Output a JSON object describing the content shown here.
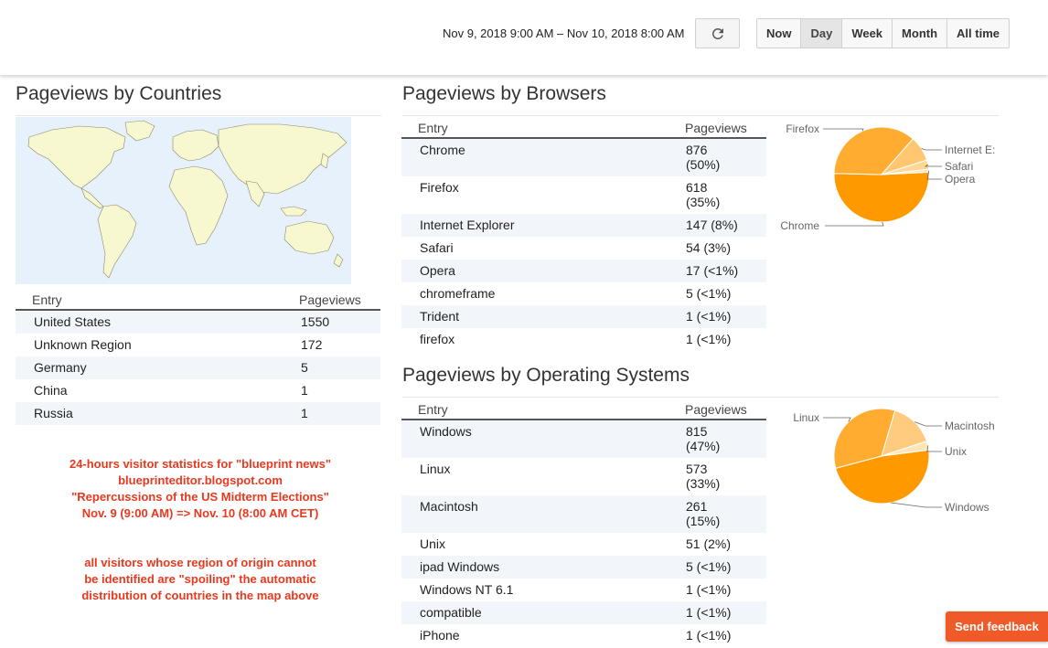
{
  "header": {
    "date_range": "Nov 9, 2018 9:00 AM – Nov 10, 2018 8:00 AM",
    "ranges": [
      {
        "label": "Now",
        "active": false
      },
      {
        "label": "Day",
        "active": true
      },
      {
        "label": "Week",
        "active": false
      },
      {
        "label": "Month",
        "active": false
      },
      {
        "label": "All time",
        "active": false
      }
    ],
    "refresh_icon": "refresh-icon"
  },
  "countries": {
    "title": "Pageviews by Countries",
    "col_entry": "Entry",
    "col_views": "Pageviews",
    "rows": [
      {
        "entry": "United States",
        "views": "1550"
      },
      {
        "entry": "Unknown Region",
        "views": "172"
      },
      {
        "entry": "Germany",
        "views": "5"
      },
      {
        "entry": "China",
        "views": "1"
      },
      {
        "entry": "Russia",
        "views": "1"
      }
    ]
  },
  "annotation": {
    "lines1": [
      "24-hours visitor statistics for \"blueprint news\"",
      "blueprinteditor.blogspot.com",
      "\"Repercussions of the US Midterm Elections\"",
      "Nov. 9 (9:00 AM) => Nov. 10 (8:00 AM CET)"
    ],
    "lines2": [
      "all visitors whose region of origin cannot",
      "be identified are \"spoiling\" the automatic",
      "distribution of countries in the map above"
    ]
  },
  "browsers": {
    "title": "Pageviews by Browsers",
    "col_entry": "Entry",
    "col_views": "Pageviews",
    "rows": [
      {
        "entry": "Chrome",
        "views": "876",
        "pct": "(50%)"
      },
      {
        "entry": "Firefox",
        "views": "618",
        "pct": "(35%)"
      },
      {
        "entry": "Internet Explorer",
        "views": "147 (8%)",
        "pct": ""
      },
      {
        "entry": "Safari",
        "views": "54 (3%)",
        "pct": ""
      },
      {
        "entry": "Opera",
        "views": "17 (<1%)",
        "pct": ""
      },
      {
        "entry": "chromeframe",
        "views": "5 (<1%)",
        "pct": ""
      },
      {
        "entry": "Trident",
        "views": "1 (<1%)",
        "pct": ""
      },
      {
        "entry": "firefox",
        "views": "1 (<1%)",
        "pct": ""
      }
    ]
  },
  "os": {
    "title": "Pageviews by Operating Systems",
    "col_entry": "Entry",
    "col_views": "Pageviews",
    "rows": [
      {
        "entry": "Windows",
        "views": "815",
        "pct": "(47%)"
      },
      {
        "entry": "Linux",
        "views": "573",
        "pct": "(33%)"
      },
      {
        "entry": "Macintosh",
        "views": "261",
        "pct": "(15%)"
      },
      {
        "entry": "Unix",
        "views": "51 (2%)",
        "pct": ""
      },
      {
        "entry": "ipad Windows",
        "views": "5 (<1%)",
        "pct": ""
      },
      {
        "entry": "Windows NT 6.1",
        "views": "1 (<1%)",
        "pct": ""
      },
      {
        "entry": "compatible",
        "views": "1 (<1%)",
        "pct": ""
      },
      {
        "entry": "iPhone",
        "views": "1 (<1%)",
        "pct": ""
      }
    ]
  },
  "chart_data": [
    {
      "type": "pie",
      "slices": [
        {
          "label": "Chrome",
          "value": 876,
          "color": "#ff9900"
        },
        {
          "label": "Firefox",
          "value": 618,
          "color": "#ffac30"
        },
        {
          "label": "Internet E:",
          "value": 147,
          "color": "#ffc870"
        },
        {
          "label": "Safari",
          "value": 54,
          "color": "#ffd894"
        },
        {
          "label": "Opera",
          "value": 17,
          "color": "#ffe6b8"
        }
      ]
    },
    {
      "type": "pie",
      "slices": [
        {
          "label": "Windows",
          "value": 815,
          "color": "#ff9900"
        },
        {
          "label": "Linux",
          "value": 573,
          "color": "#ffac30"
        },
        {
          "label": "Macintosh",
          "value": 261,
          "color": "#ffcc7f"
        },
        {
          "label": "Unix",
          "value": 51,
          "color": "#ffe6b8"
        }
      ]
    }
  ],
  "feedback": {
    "label": "Send feedback"
  }
}
